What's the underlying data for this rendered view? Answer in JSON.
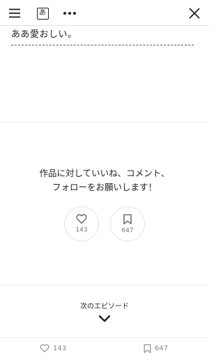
{
  "toolbar": {
    "font_glyph": "あ",
    "icons": [
      "hamburger-menu-icon",
      "font-size-icon",
      "more-dots-icon",
      "close-icon"
    ]
  },
  "reader": {
    "last_line": "ああ愛おしい。"
  },
  "cta": {
    "line1": "作品に対していいね、コメント、",
    "line2": "フォローをお願いします！"
  },
  "reactions": {
    "like_count": "143",
    "bookmark_count": "647"
  },
  "next_episode": {
    "label": "次のエピソード"
  },
  "bottom_bar": {
    "like_count": "143",
    "bookmark_count": "647"
  }
}
